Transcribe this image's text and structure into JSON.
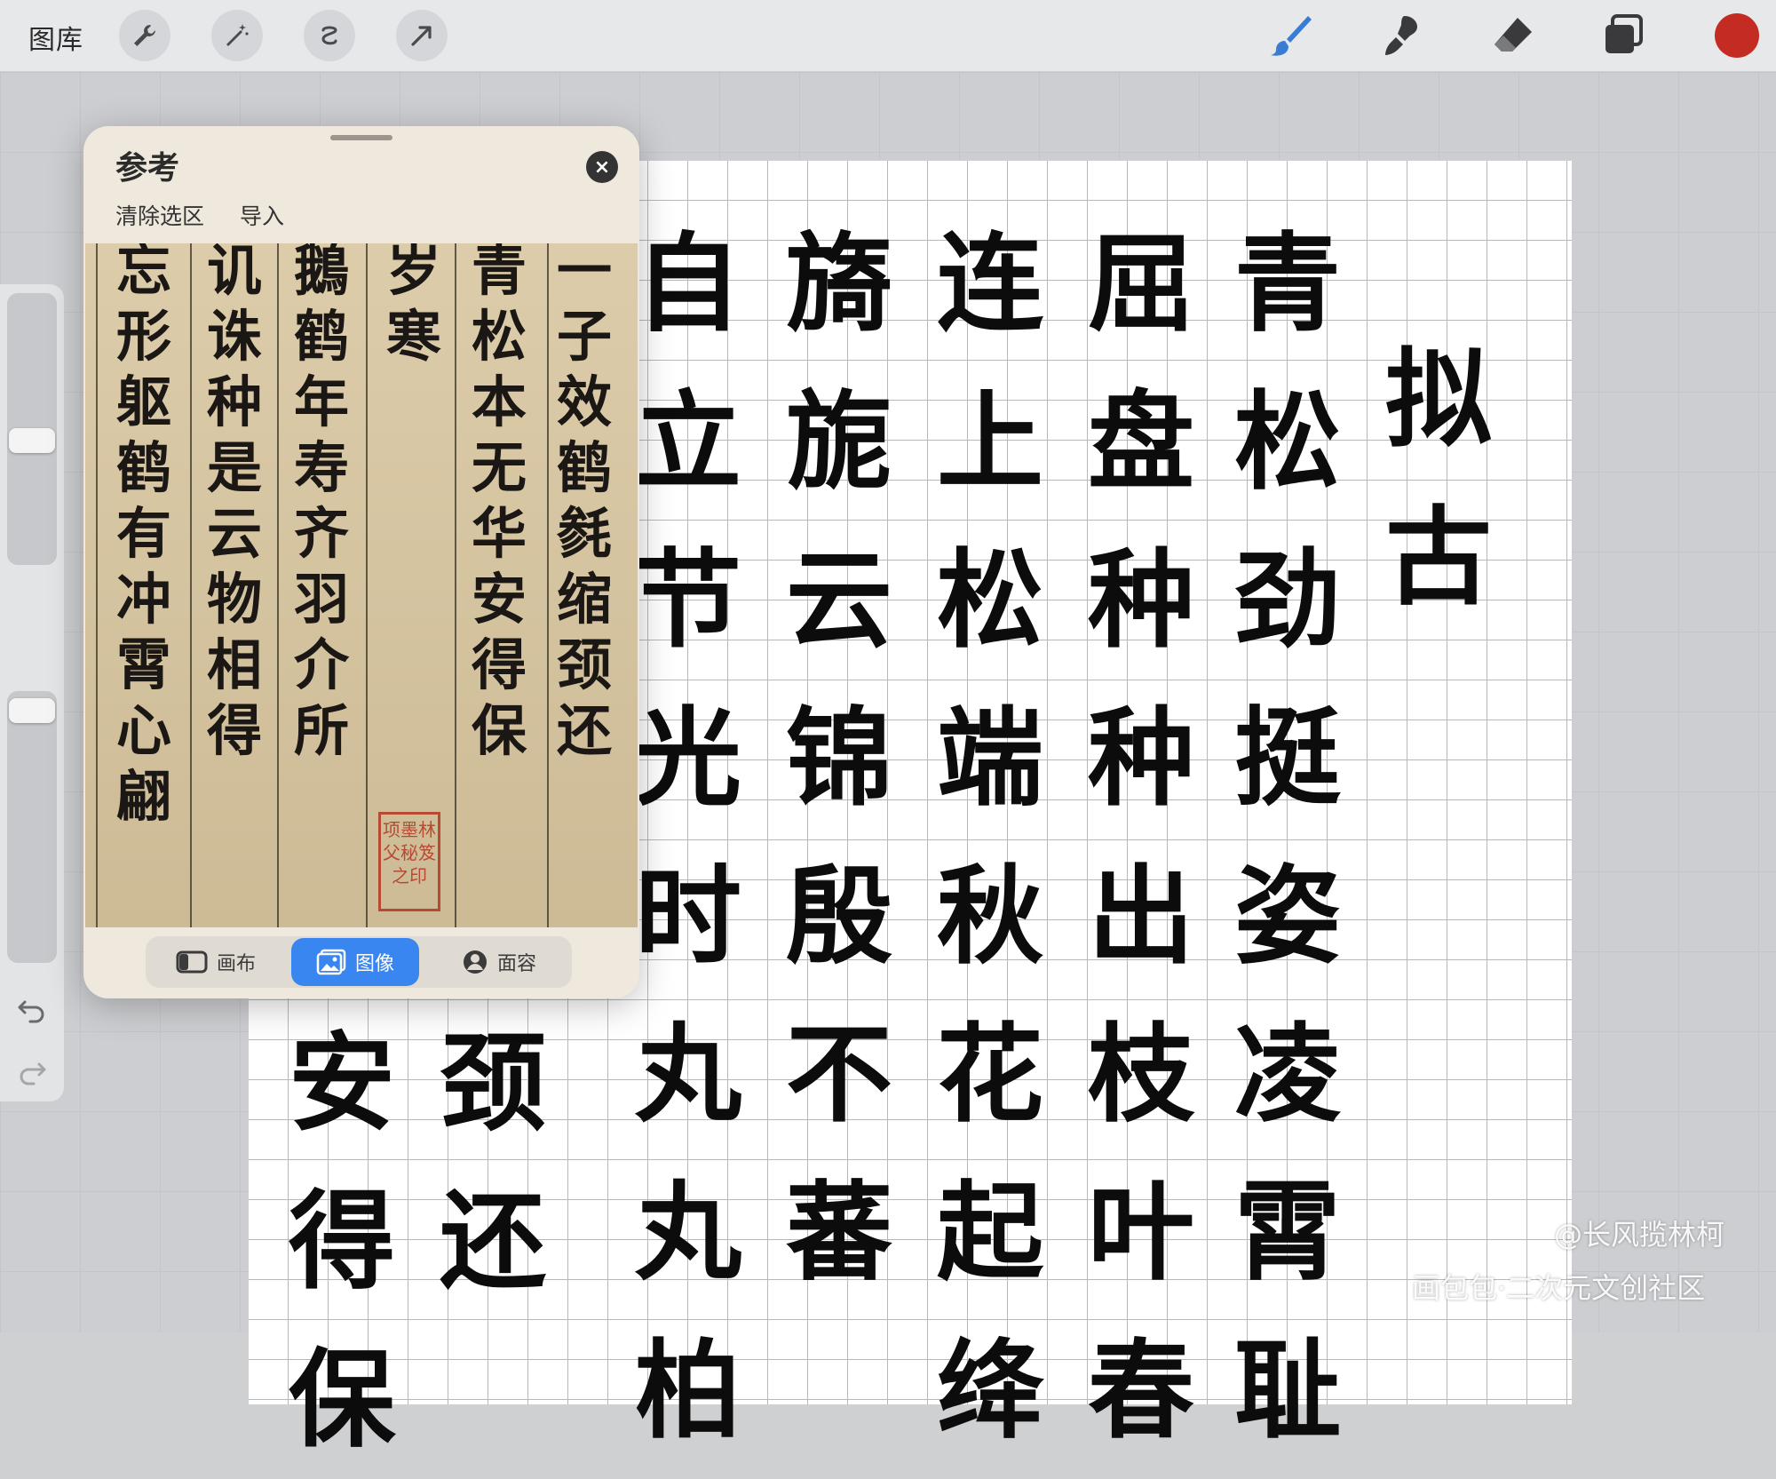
{
  "toolbar": {
    "gallery_label": "图库",
    "left_tools": [
      "wrench-icon",
      "magic-wand-icon",
      "selection-icon",
      "transform-arrow-icon"
    ],
    "right_tools": [
      "brush-icon",
      "smudge-icon",
      "eraser-icon",
      "layers-icon"
    ],
    "current_color": "#c42b22",
    "brush_color": "#3a7bd5"
  },
  "reference": {
    "title": "参考",
    "clear_selection": "清除选区",
    "import": "导入",
    "close_icon": "×",
    "image_columns": [
      "一子效鹤毵缩颈还",
      "青松本无华安得保",
      "岁寒",
      "鵝鹤年寿齐羽介所",
      "讥诛种是云物相得",
      "忘形躯鹤有冲霄心翩"
    ],
    "seal_text": "项墨林父秘笈之印",
    "segments": [
      {
        "label": "画布",
        "icon": "canvas-icon"
      },
      {
        "label": "图像",
        "icon": "image-icon"
      },
      {
        "label": "面容",
        "icon": "face-icon"
      }
    ],
    "active_segment": "图像"
  },
  "canvas": {
    "columns": [
      "拟古",
      "青松劲挺姿凌霄耻",
      "屈盘种种出枝叶春",
      "连上松端秋花起绛",
      "旖旎云锦殷不蕃",
      "自立节光时丸丸柏",
      "颈还",
      "安得保"
    ]
  },
  "watermark": {
    "line1": "@长风揽林柯",
    "line2": "画包包·二次元文创社区"
  }
}
